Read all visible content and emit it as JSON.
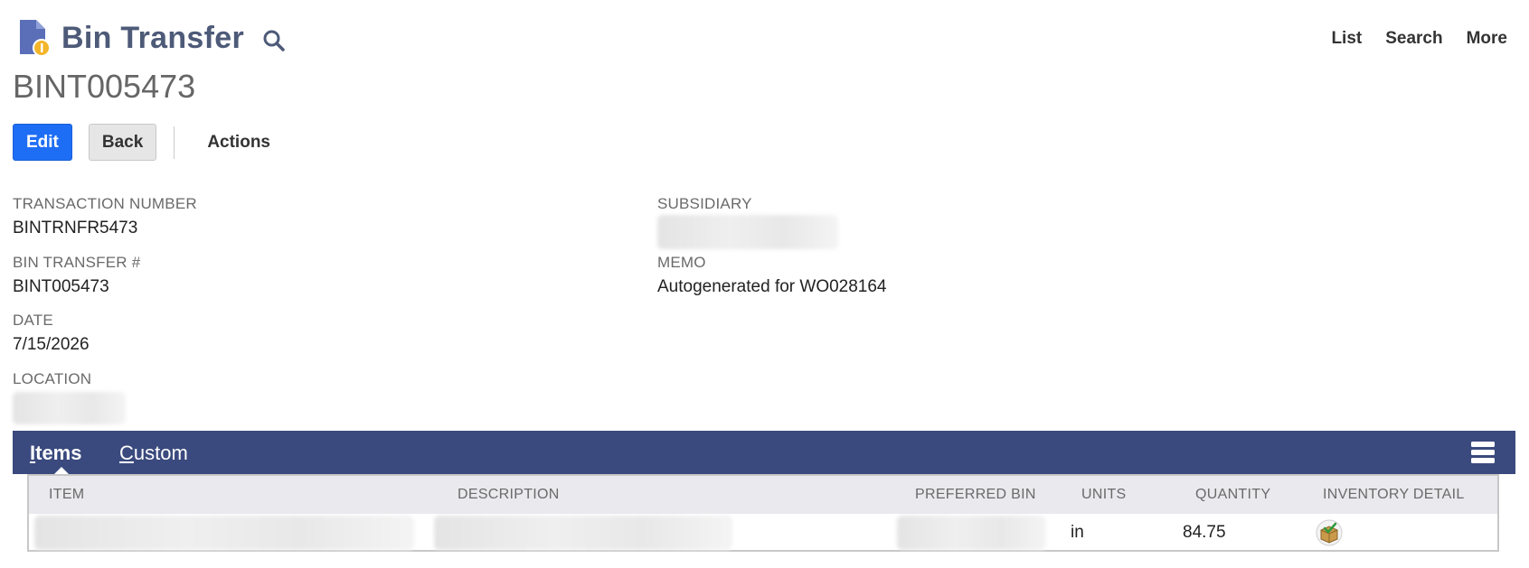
{
  "header": {
    "title": "Bin Transfer",
    "record_icon": "bin-transfer-record-icon",
    "search_icon": "search-icon"
  },
  "top_links": [
    "List",
    "Search",
    "More"
  ],
  "record_id": "BINT005473",
  "buttons": {
    "edit": "Edit",
    "back": "Back",
    "actions": "Actions"
  },
  "fields": {
    "transaction_number": {
      "label": "TRANSACTION NUMBER",
      "value": "BINTRNFR5473"
    },
    "bin_transfer": {
      "label": "BIN TRANSFER #",
      "value": "BINT005473"
    },
    "date": {
      "label": "DATE",
      "value": "7/15/2026"
    },
    "location": {
      "label": "LOCATION",
      "value": ""
    },
    "subsidiary": {
      "label": "SUBSIDIARY",
      "value": ""
    },
    "memo": {
      "label": "MEMO",
      "value": "Autogenerated for WO028164"
    }
  },
  "tabs": [
    {
      "first": "I",
      "rest": "tems"
    },
    {
      "first": "C",
      "rest": "ustom"
    }
  ],
  "table": {
    "headers": [
      "ITEM",
      "DESCRIPTION",
      "PREFERRED BIN",
      "UNITS",
      "QUANTITY",
      "INVENTORY DETAIL"
    ],
    "rows": [
      {
        "item": "",
        "description": "",
        "preferred_bin": "",
        "units": "in",
        "quantity": "84.75",
        "inventory_detail_icon": "inventory-detail-icon"
      }
    ]
  },
  "colors": {
    "accent": "#1e6ef5",
    "tab_bar": "#3a4a7e",
    "title": "#4d5a78"
  }
}
